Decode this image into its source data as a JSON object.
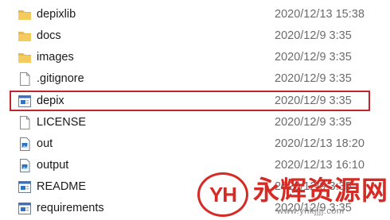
{
  "files": [
    {
      "name": "depixlib",
      "date": "2020/12/13 15:38",
      "icon": "folder-icon"
    },
    {
      "name": "docs",
      "date": "2020/12/9 3:35",
      "icon": "folder-icon"
    },
    {
      "name": "images",
      "date": "2020/12/9 3:35",
      "icon": "folder-icon"
    },
    {
      "name": ".gitignore",
      "date": "2020/12/9 3:35",
      "icon": "blank-file-icon"
    },
    {
      "name": "depix",
      "date": "2020/12/9 3:35",
      "icon": "python-file-icon",
      "selected": true
    },
    {
      "name": "LICENSE",
      "date": "2020/12/9 3:35",
      "icon": "blank-file-icon"
    },
    {
      "name": "out",
      "date": "2020/12/13 18:20",
      "icon": "image-file-icon"
    },
    {
      "name": "output",
      "date": "2020/12/13 16:10",
      "icon": "image-file-icon"
    },
    {
      "name": "README",
      "date": "2020/12/9 3:35",
      "icon": "python-file-icon"
    },
    {
      "name": "requirements",
      "date": "2020/12/9 3:35",
      "icon": "python-file-icon"
    }
  ],
  "colors": {
    "folder": "#e8b94a",
    "selection_border": "#c0262d",
    "watermark": "#d62a24"
  },
  "watermark": {
    "badge": "YH",
    "title": "永辉资源网",
    "url": "www.yhkjjjj.com"
  }
}
